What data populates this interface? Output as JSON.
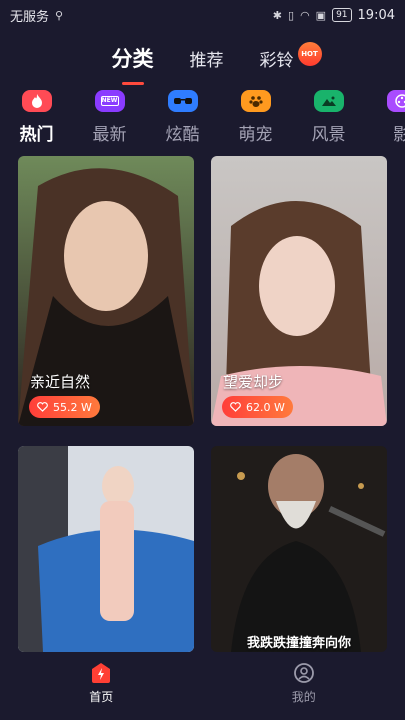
{
  "status_bar": {
    "carrier": "无服务",
    "battery": "91",
    "time": "19:04"
  },
  "top_tabs": [
    {
      "label": "分类",
      "active": true
    },
    {
      "label": "推荐",
      "active": false
    },
    {
      "label": "彩铃",
      "active": false,
      "badge": "HOT"
    }
  ],
  "categories": [
    {
      "label": "热门",
      "icon": "fire-icon",
      "active": true
    },
    {
      "label": "最新",
      "icon": "new-icon"
    },
    {
      "label": "炫酷",
      "icon": "sunglasses-icon"
    },
    {
      "label": "萌宠",
      "icon": "paw-icon"
    },
    {
      "label": "风景",
      "icon": "landscape-icon"
    },
    {
      "label": "影",
      "icon": "film-icon"
    }
  ],
  "cards": [
    {
      "title": "亲近自然",
      "likes": "55.2 W"
    },
    {
      "title": "望爱却步",
      "likes": "62.0 W"
    },
    {
      "title": "",
      "likes": ""
    },
    {
      "title": "",
      "caption": "我跌跌撞撞奔向你"
    }
  ],
  "bottom_nav": [
    {
      "label": "首页",
      "active": true
    },
    {
      "label": "我的",
      "active": false
    }
  ]
}
